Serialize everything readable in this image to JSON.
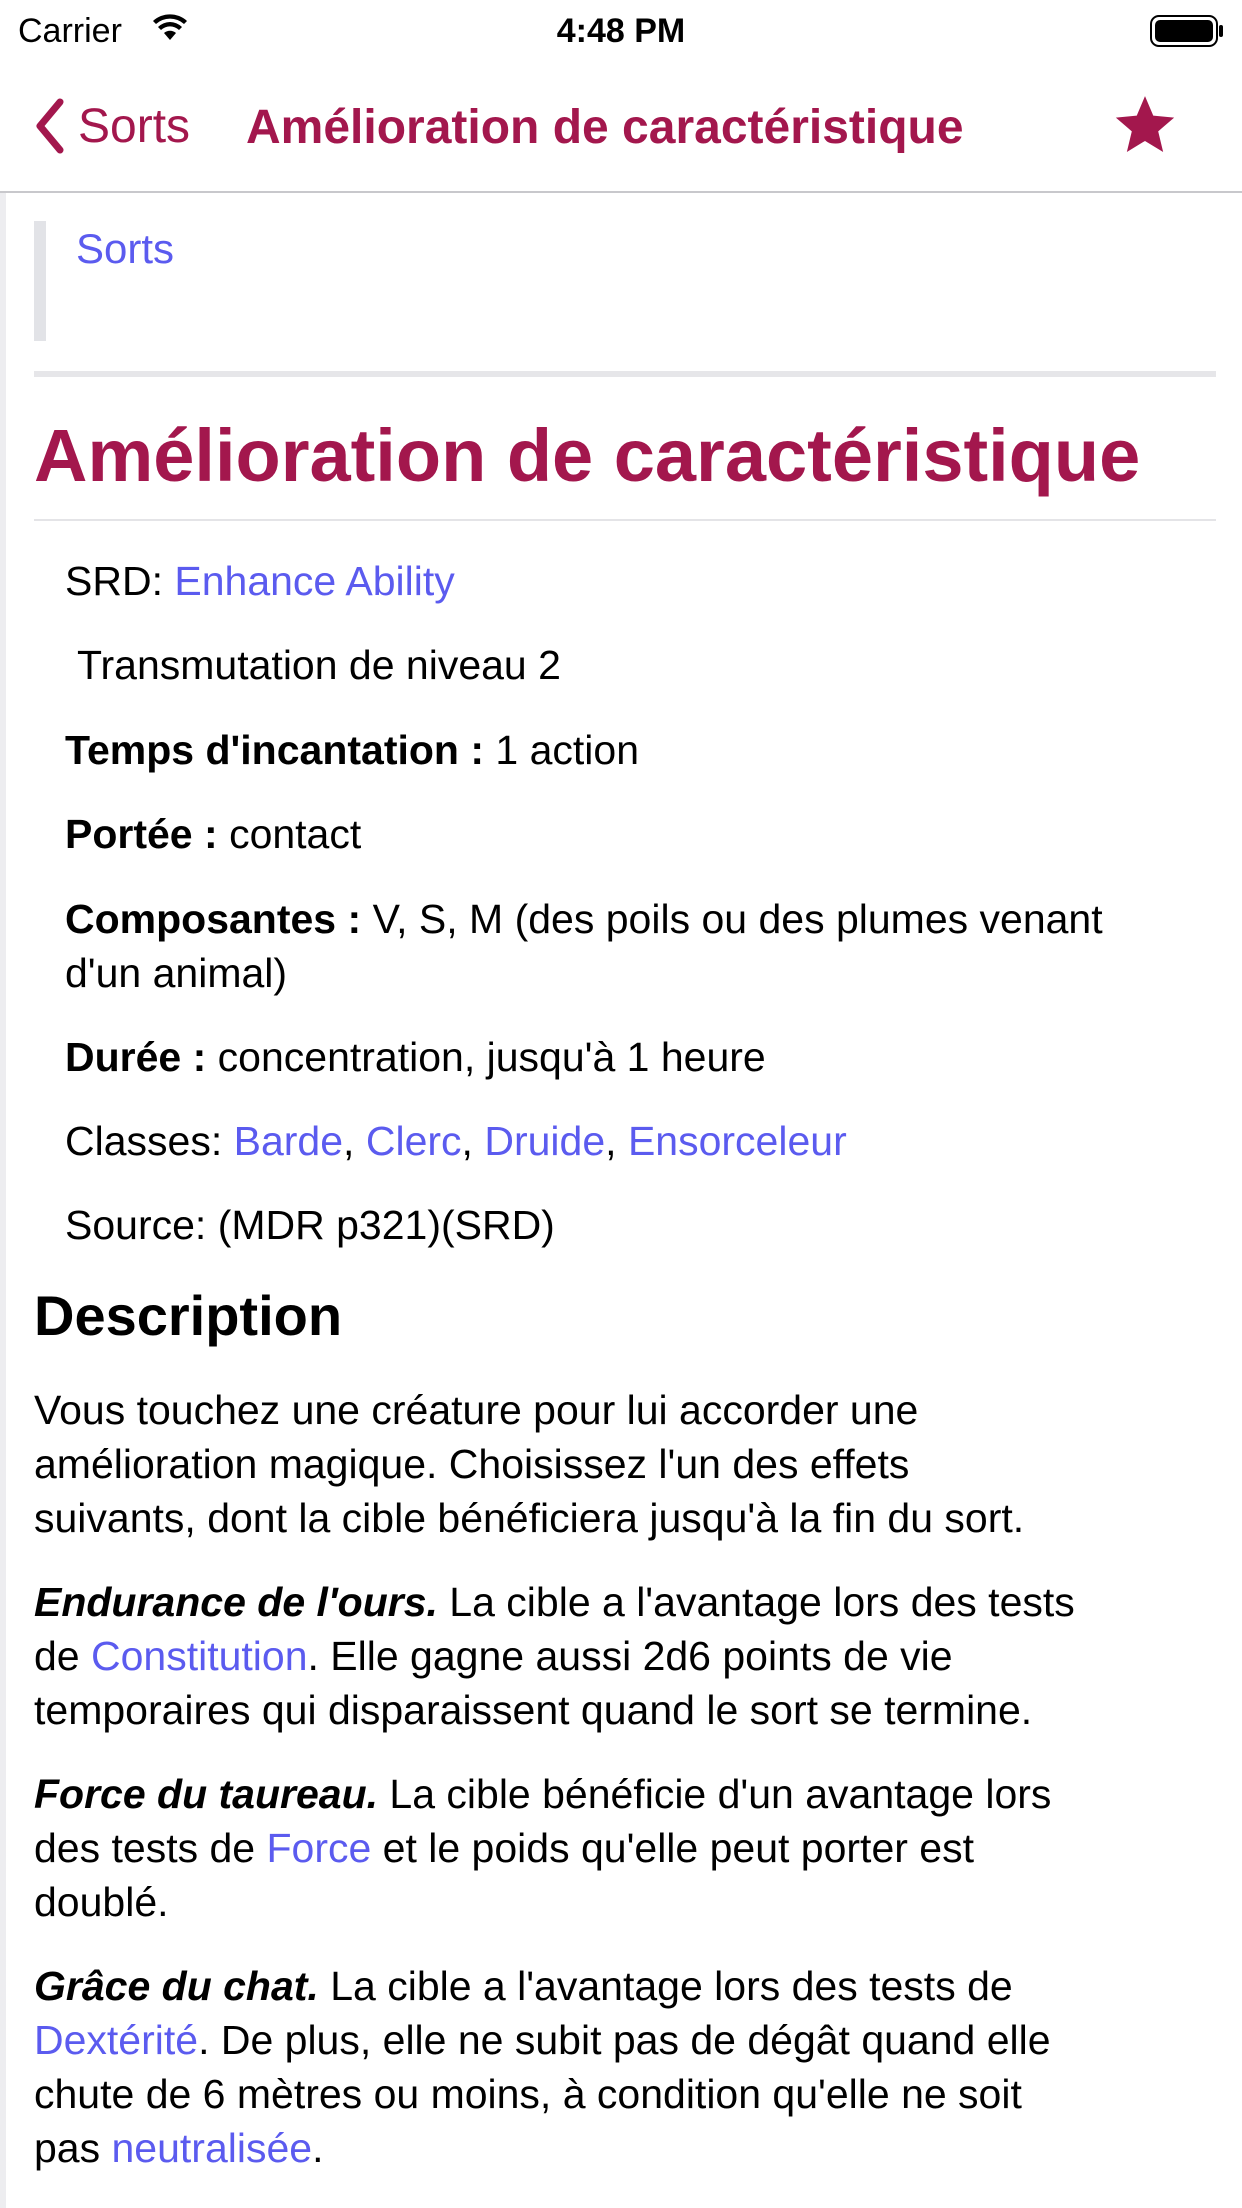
{
  "status_bar": {
    "carrier": "Carrier",
    "time": "4:48 PM"
  },
  "nav": {
    "back_label": "Sorts",
    "title": "Amélioration de caractéristique"
  },
  "breadcrumb": {
    "label": "Sorts"
  },
  "spell": {
    "title": "Amélioration de caractéristique",
    "srd_label": "SRD:",
    "srd_link": "Enhance Ability",
    "school": "Transmutation de niveau 2",
    "casting_time_label": "Temps d'incantation :",
    "casting_time": "1 action",
    "range_label": "Portée :",
    "range": "contact",
    "components_label": "Composantes :",
    "components_line1": "V, S, M (des poils ou des plumes venant",
    "components_line2": "d'un animal)",
    "duration_label": "Durée :",
    "duration": "concentration, jusqu'à 1 heure",
    "classes_label": "Classes:",
    "classes": [
      "Barde",
      "Clerc",
      "Druide",
      "Ensorceleur"
    ],
    "separator": ",",
    "source": "Source: (MDR p321)(SRD)"
  },
  "description": {
    "heading": "Description",
    "intro_line1": "Vous touchez une créature pour lui accorder une",
    "intro_line2": "amélioration magique. Choisissez l'un des effets",
    "intro_line3": "suivants, dont la cible bénéficiera jusqu'à la fin du sort.",
    "bear_title": "Endurance de l'ours.",
    "bear_text1": " La cible a l'avantage lors des tests",
    "bear_text2a": "de ",
    "bear_link": "Constitution",
    "bear_text2b": ". Elle gagne aussi 2d6 points de vie",
    "bear_text3": "temporaires qui disparaissent quand le sort se termine.",
    "bull_title": "Force du taureau.",
    "bull_text1": " La cible bénéficie d'un avantage lors",
    "bull_text2a": "des tests de ",
    "bull_link": "Force",
    "bull_text2b": " et le poids qu'elle peut porter est",
    "bull_text3": "doublé.",
    "cat_title": "Grâce du chat.",
    "cat_text1": " La cible a l'avantage lors des tests de",
    "cat_link": "Dextérité",
    "cat_text2": ". De plus, elle ne subit pas de dégât quand elle",
    "cat_text3": "chute de 6 mètres ou moins, à condition qu'elle ne soit",
    "cat_text4a": "pas ",
    "cat_link2": "neutralisée",
    "cat_text4b": "."
  },
  "colors": {
    "accent": "#a3174d",
    "link": "#5b5bef"
  }
}
